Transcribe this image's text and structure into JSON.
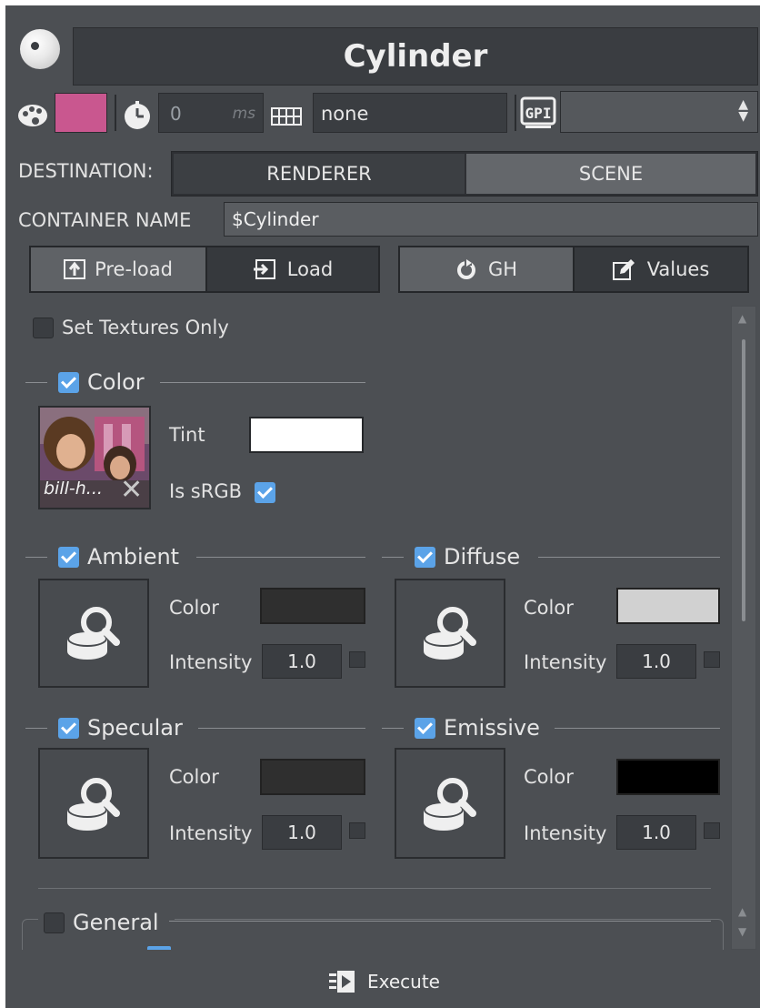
{
  "header": {
    "title": "Cylinder"
  },
  "toolbar": {
    "swatch_color": "#c9578f",
    "time_value": "0",
    "time_unit": "ms",
    "layer_value": "none",
    "gpi_icon": "gpi-icon",
    "gpi_select_value": ""
  },
  "destination": {
    "label": "DESTINATION:",
    "options": [
      "RENDERER",
      "SCENE"
    ],
    "selected": "RENDERER"
  },
  "container": {
    "label": "CONTAINER NAME",
    "value": "$Cylinder"
  },
  "actions": {
    "preload": "Pre-load",
    "load": "Load",
    "gh": "GH",
    "values": "Values"
  },
  "set_textures_only": {
    "label": "Set Textures Only",
    "checked": false
  },
  "color_section": {
    "title": "Color",
    "checked": true,
    "image_name": "bill-h...",
    "tint_label": "Tint",
    "tint_color": "#ffffff",
    "srgb_label": "Is sRGB",
    "srgb_checked": true
  },
  "materials": [
    {
      "title": "Ambient",
      "checked": true,
      "color_label": "Color",
      "color": "#2f2f2f",
      "intensity_label": "Intensity",
      "intensity": "1.0"
    },
    {
      "title": "Diffuse",
      "checked": true,
      "color_label": "Color",
      "color": "#d1d1d1",
      "intensity_label": "Intensity",
      "intensity": "1.0"
    },
    {
      "title": "Specular",
      "checked": true,
      "color_label": "Color",
      "color": "#2f2f2f",
      "intensity_label": "Intensity",
      "intensity": "1.0"
    },
    {
      "title": "Emissive",
      "checked": true,
      "color_label": "Color",
      "color": "#000000",
      "intensity_label": "Intensity",
      "intensity": "1.0"
    }
  ],
  "general": {
    "title": "General",
    "checked": false
  },
  "footer": {
    "execute": "Execute"
  }
}
